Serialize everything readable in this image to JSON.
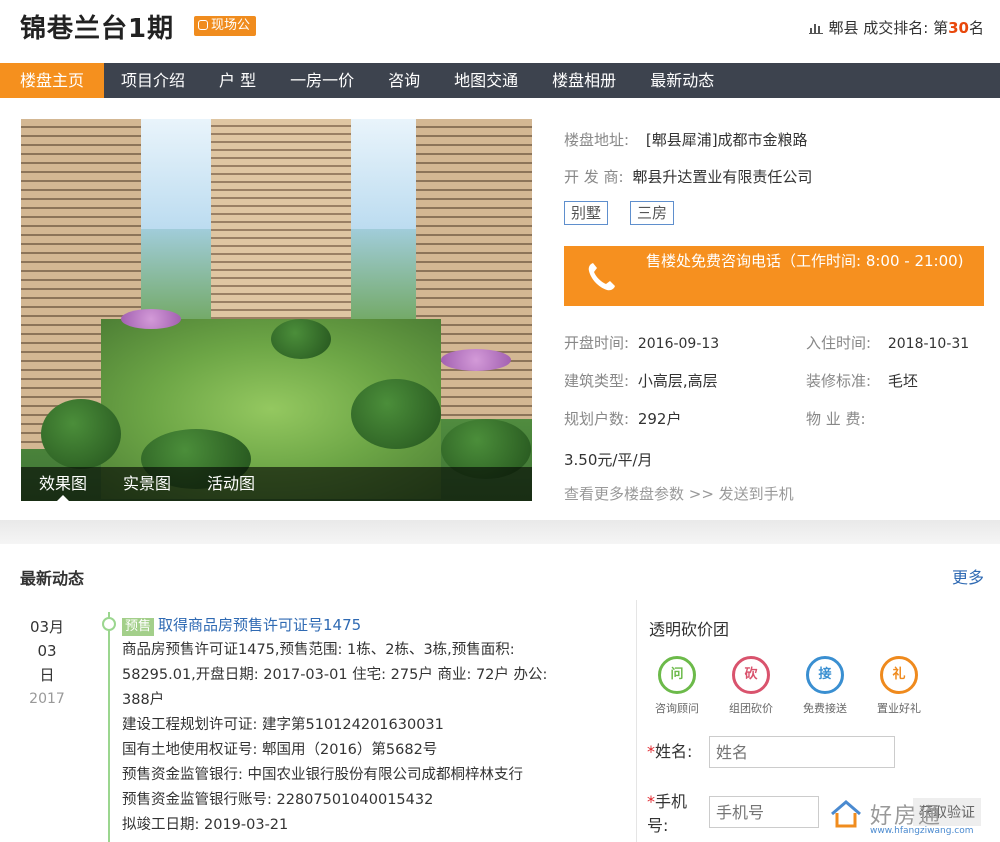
{
  "header": {
    "title": "锦巷兰台1期",
    "badge": "现场公",
    "rank_prefix": "郫县 成交排名: 第",
    "rank_num": "30",
    "rank_suffix": "名"
  },
  "nav": {
    "items": [
      "楼盘主页",
      "项目介绍",
      "户 型",
      "一房一价",
      "咨询",
      "地图交通",
      "楼盘相册",
      "最新动态"
    ],
    "active_index": 0
  },
  "gallery": {
    "tabs": [
      "效果图",
      "实景图",
      "活动图"
    ]
  },
  "info": {
    "address_label": "楼盘地址:",
    "address": "[郫县犀浦]成都市金粮路",
    "developer_label": "开 发 商:",
    "developer": "郫县升达置业有限责任公司",
    "tags": [
      "别墅",
      "三房"
    ],
    "hotline": "售楼处免费咨询电话（工作时间: 8:00 - 21:00)",
    "open_label": "开盘时间:",
    "open_date": "2016-09-13",
    "checkin_label": "入住时间:",
    "checkin_date": "2018-10-31",
    "type_label": "建筑类型:",
    "type": "小高层,高层",
    "deco_label": "装修标准:",
    "deco": "毛坯",
    "units_label": "规划户数:",
    "units": "292户",
    "fee_label": "物 业 费:",
    "fee": "3.50元/平/月",
    "more_link": "查看更多楼盘参数 >> 发送到手机"
  },
  "news": {
    "title": "最新动态",
    "more": "更多",
    "date_day": "03月03",
    "date_ri": "日",
    "date_year": "2017",
    "badge": "预售",
    "headline": "取得商品房预售许可证号1475",
    "lines": [
      "商品房预售许可证1475,预售范围: 1栋、2栋、3栋,预售面积:",
      "58295.01,开盘日期: 2017-03-01 住宅: 275户 商业: 72户 办公:",
      "388户",
      "建设工程规划许可证: 建字第510124201630031",
      "国有土地使用权证号: 郫国用（2016）第5682号",
      "预售资金监管银行: 中国农业银行股份有限公司成都桐梓林支行",
      "预售资金监管银行账号: 22807501040015432",
      "拟竣工日期: 2019-03-21"
    ]
  },
  "side": {
    "title": "透明砍价团",
    "services": [
      {
        "glyph": "问",
        "label": "咨询顾问",
        "color": "#6cba4a"
      },
      {
        "glyph": "砍",
        "label": "组团砍价",
        "color": "#d9536d"
      },
      {
        "glyph": "接",
        "label": "免费接送",
        "color": "#3a8fd1"
      },
      {
        "glyph": "礼",
        "label": "置业好礼",
        "color": "#ef8a1d"
      }
    ],
    "name_label": "姓名:",
    "name_placeholder": "姓名",
    "phone_label_1": "手机",
    "phone_label_2": "号:",
    "phone_placeholder": "手机号",
    "code_button": "获取验证"
  },
  "watermark": {
    "text": "好房通",
    "url": "www.hfangziwang.com"
  }
}
